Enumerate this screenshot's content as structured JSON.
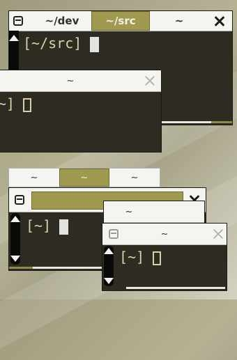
{
  "top_window": {
    "tabs": [
      {
        "label": "~/dev",
        "active": false
      },
      {
        "label": "~/src",
        "active": true
      },
      {
        "label": "~",
        "active": false
      }
    ],
    "prompt": "[~/src] "
  },
  "top_overlay_window": {
    "title": "~",
    "prompt": "~] "
  },
  "bottom_window": {
    "tabs": [
      {
        "label": "~",
        "active": false
      },
      {
        "label": "~",
        "active": true
      },
      {
        "label": "~",
        "active": false
      }
    ],
    "prompt": "[~] "
  },
  "bottom_small_window": {
    "tab": "~"
  },
  "bottom_front_window": {
    "title": "~",
    "prompt": "[~] "
  },
  "colors": {
    "accent": "#9f9a50",
    "terminal_bg": "#2e2c22",
    "prompt_text": "#d8d2a6"
  }
}
